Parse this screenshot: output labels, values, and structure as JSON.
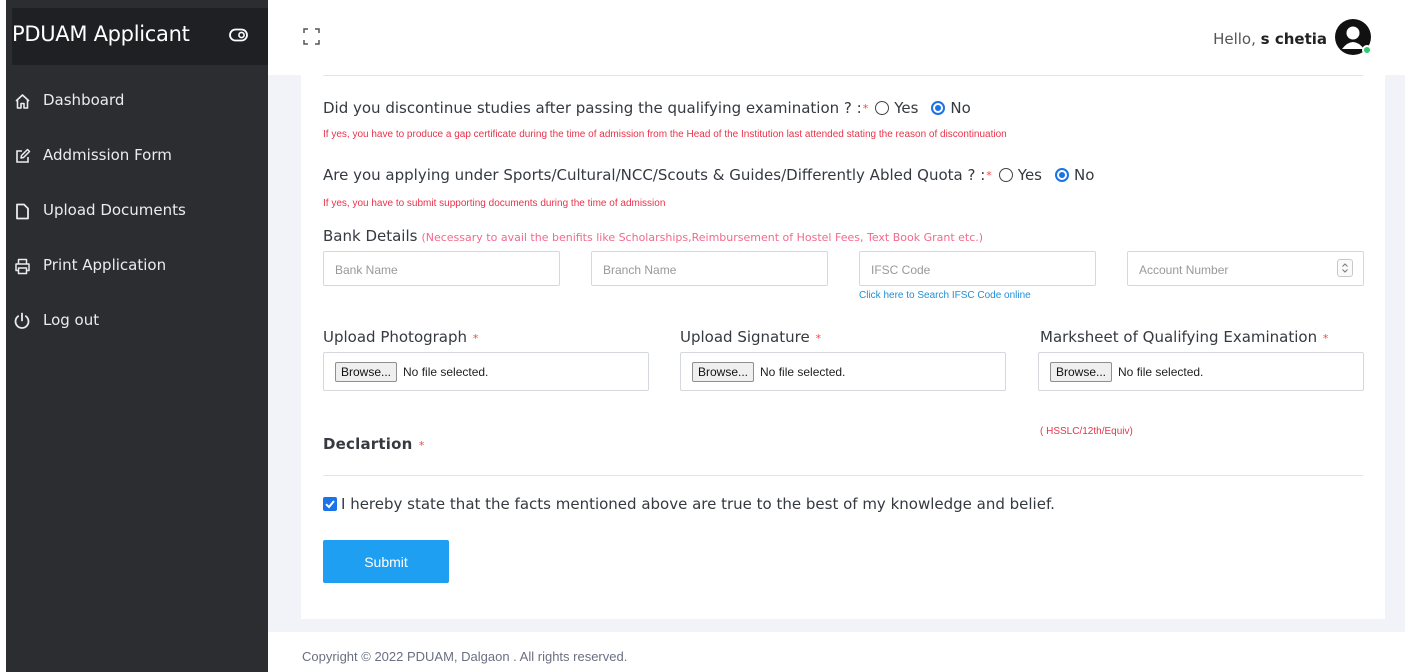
{
  "sidebar": {
    "brand": "PDUAM Applicant",
    "items": [
      {
        "label": "Dashboard",
        "icon": "home-icon"
      },
      {
        "label": "Addmission Form",
        "icon": "edit-icon"
      },
      {
        "label": "Upload Documents",
        "icon": "file-icon"
      },
      {
        "label": "Print Application",
        "icon": "printer-icon"
      },
      {
        "label": "Log out",
        "icon": "power-icon"
      }
    ]
  },
  "topbar": {
    "greeting": "Hello,",
    "user_name": "s chetia"
  },
  "form": {
    "q1": {
      "text": "Did you discontinue studies after passing the qualifying examination ? :",
      "required_mark": "*",
      "options": [
        "Yes",
        "No"
      ],
      "selected": "No",
      "note": "If yes, you have to produce a gap certificate during the time of admission from the Head of the Institution last attended stating the reason of discontinuation"
    },
    "q2": {
      "text": "Are you applying under Sports/Cultural/NCC/Scouts & Guides/Differently Abled Quota ? :",
      "required_mark": "*",
      "options": [
        "Yes",
        "No"
      ],
      "selected": "No",
      "note": "If yes, you have to submit supporting documents during the time of admission"
    },
    "bank": {
      "title": "Bank Details",
      "hint": "(Necessary to avail the benifits like Scholarships,Reimbursement of Hostel Fees, Text Book Grant etc.)",
      "bank_name_placeholder": "Bank Name",
      "branch_name_placeholder": "Branch Name",
      "ifsc_placeholder": "IFSC Code",
      "account_placeholder": "Account Number",
      "ifsc_link": "Click here to Search IFSC Code online"
    },
    "uploads": [
      {
        "label": "Upload Photograph",
        "required_mark": "*",
        "button": "Browse...",
        "status": "No file selected."
      },
      {
        "label": "Upload Signature",
        "required_mark": "*",
        "button": "Browse...",
        "status": "No file selected."
      },
      {
        "label": "Marksheet of Qualifying Examination",
        "required_mark": "*",
        "button": "Browse...",
        "status": "No file selected."
      }
    ],
    "marksheet_note": "( HSSLC/12th/Equiv)",
    "declaration": {
      "title": "Declartion",
      "required_mark": "*",
      "text": "I hereby state that the facts mentioned above are true to the best of my knowledge and belief.",
      "checked": true
    },
    "submit_label": "Submit"
  },
  "footer": {
    "text": "Copyright © 2022 PDUAM, Dalgaon . All rights reserved."
  },
  "colors": {
    "sidebar_bg": "#2b2d31",
    "brand_bg": "#1f2024",
    "accent": "#1e9ff2",
    "required": "#e8334a"
  }
}
